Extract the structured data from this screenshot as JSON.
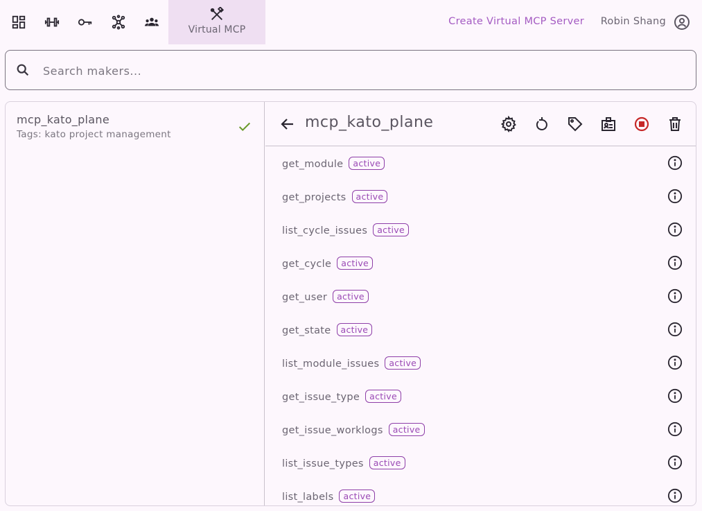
{
  "nav": {
    "icons": [
      "dashboard-icon",
      "dumbbell-icon",
      "key-icon",
      "hub-icon",
      "groups-icon"
    ],
    "active_label": "Virtual MCP",
    "active_icon": "tools-icon"
  },
  "header": {
    "create_label": "Create Virtual MCP Server",
    "user_name": "Robin Shang",
    "user_icon": "account-circle-icon"
  },
  "search": {
    "placeholder": "Search makers..."
  },
  "servers": [
    {
      "name": "mcp_kato_plane",
      "tags": "Tags: kato project management",
      "selected_icon": "check-icon"
    }
  ],
  "detail": {
    "title": "mcp_kato_plane",
    "actions": [
      "settings-icon",
      "refresh-icon",
      "tag-icon",
      "badge-icon",
      "stop-icon",
      "delete-icon"
    ],
    "tools": [
      {
        "name": "get_module",
        "status": "active"
      },
      {
        "name": "get_projects",
        "status": "active"
      },
      {
        "name": "list_cycle_issues",
        "status": "active"
      },
      {
        "name": "get_cycle",
        "status": "active"
      },
      {
        "name": "get_user",
        "status": "active"
      },
      {
        "name": "get_state",
        "status": "active"
      },
      {
        "name": "list_module_issues",
        "status": "active"
      },
      {
        "name": "get_issue_type",
        "status": "active"
      },
      {
        "name": "get_issue_worklogs",
        "status": "active"
      },
      {
        "name": "list_issue_types",
        "status": "active"
      },
      {
        "name": "list_labels",
        "status": "active"
      }
    ]
  },
  "colors": {
    "accent": "#a45bc2",
    "active_nav_bg": "#efdff2",
    "check": "#6a9a2a",
    "stop": "#c62828"
  }
}
